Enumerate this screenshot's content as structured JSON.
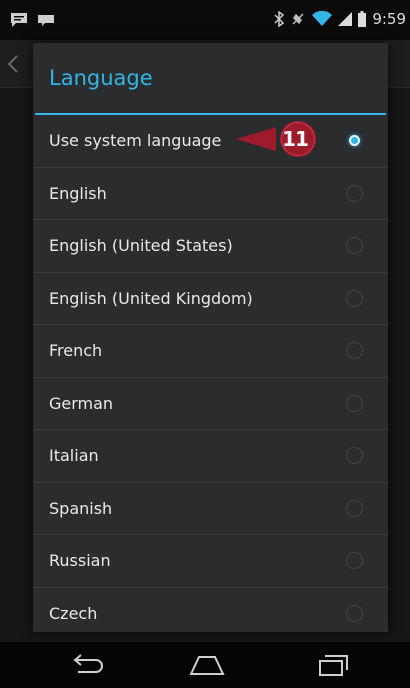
{
  "status_bar": {
    "time": "9:59",
    "icons": [
      "chat-icon",
      "voicemail-icon",
      "bluetooth-icon",
      "mute-icon",
      "wifi-icon",
      "cell-signal-icon",
      "battery-icon"
    ]
  },
  "dialog": {
    "title": "Language",
    "options": [
      {
        "label": "Use system language",
        "selected": true
      },
      {
        "label": "English",
        "selected": false
      },
      {
        "label": "English (United States)",
        "selected": false
      },
      {
        "label": "English (United Kingdom)",
        "selected": false
      },
      {
        "label": "French",
        "selected": false
      },
      {
        "label": "German",
        "selected": false
      },
      {
        "label": "Italian",
        "selected": false
      },
      {
        "label": "Spanish",
        "selected": false
      },
      {
        "label": "Russian",
        "selected": false
      },
      {
        "label": "Czech",
        "selected": false
      }
    ]
  },
  "callout": {
    "step": "11",
    "color": "#9e1b2b"
  },
  "nav_bar": {
    "buttons": [
      "back-icon",
      "home-icon",
      "recent-apps-icon"
    ]
  },
  "colors": {
    "accent": "#33b5e5",
    "dialog_bg": "#2b2c2e"
  }
}
